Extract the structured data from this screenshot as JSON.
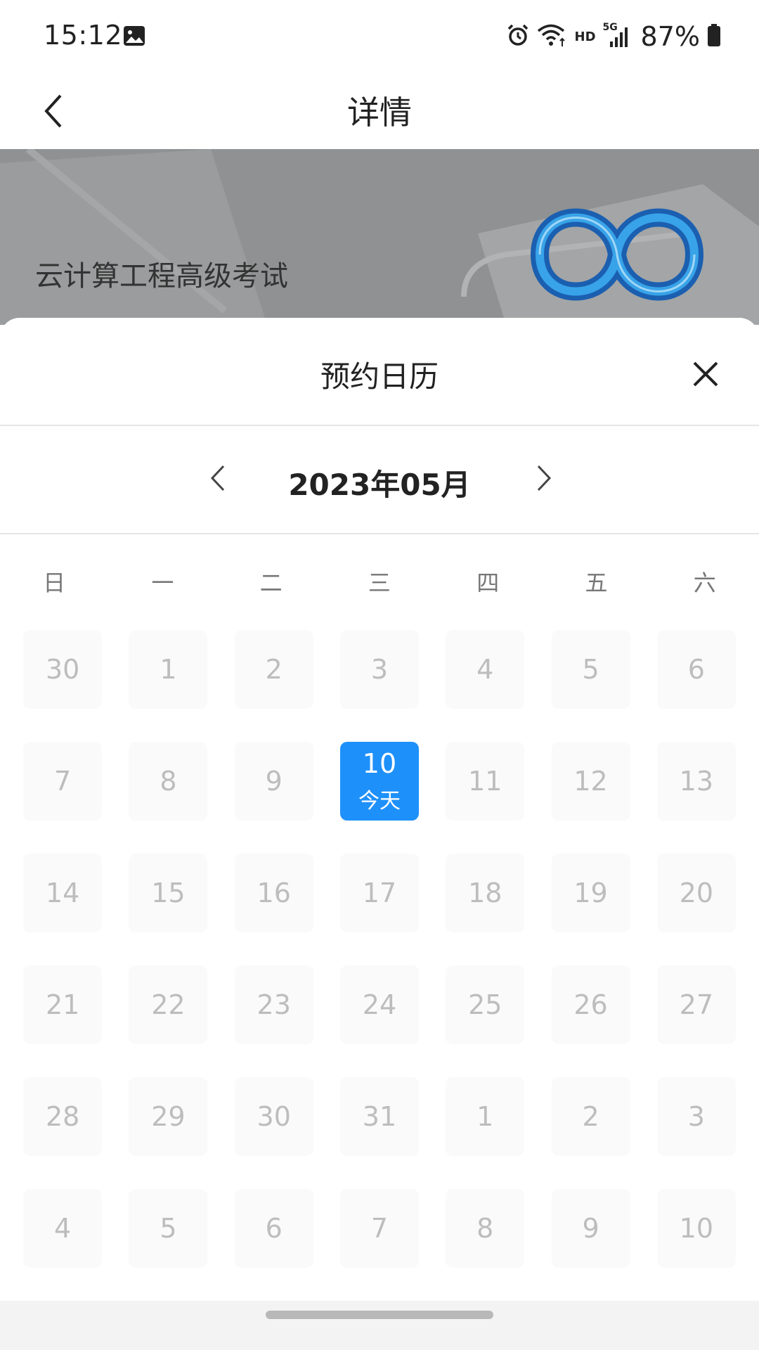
{
  "status_bar": {
    "time": "15:12",
    "battery": "87%",
    "network": "HD",
    "network_gen": "5G",
    "icons": [
      "gallery-icon",
      "alarm-icon",
      "wifi-icon",
      "signal-icon",
      "battery-icon"
    ]
  },
  "header": {
    "title": "详情",
    "back_icon": "chevron-left-icon"
  },
  "banner": {
    "title": "云计算工程高级考试"
  },
  "calendar_sheet": {
    "title": "预约日历",
    "close_icon": "close-icon",
    "month_label": "2023年05月",
    "weekdays": [
      "日",
      "一",
      "二",
      "三",
      "四",
      "五",
      "六"
    ],
    "weeks": [
      [
        "30",
        "1",
        "2",
        "3",
        "4",
        "5",
        "6"
      ],
      [
        "7",
        "8",
        "9",
        "10",
        "11",
        "12",
        "13"
      ],
      [
        "14",
        "15",
        "16",
        "17",
        "18",
        "19",
        "20"
      ],
      [
        "21",
        "22",
        "23",
        "24",
        "25",
        "26",
        "27"
      ],
      [
        "28",
        "29",
        "30",
        "31",
        "1",
        "2",
        "3"
      ],
      [
        "4",
        "5",
        "6",
        "7",
        "8",
        "9",
        "10"
      ]
    ],
    "today": {
      "week": 1,
      "day": 3,
      "label": "今天"
    }
  },
  "colors": {
    "accent": "#1e90fa",
    "disabled_text": "#bdbdbd",
    "cell_background": "#fafafa"
  }
}
